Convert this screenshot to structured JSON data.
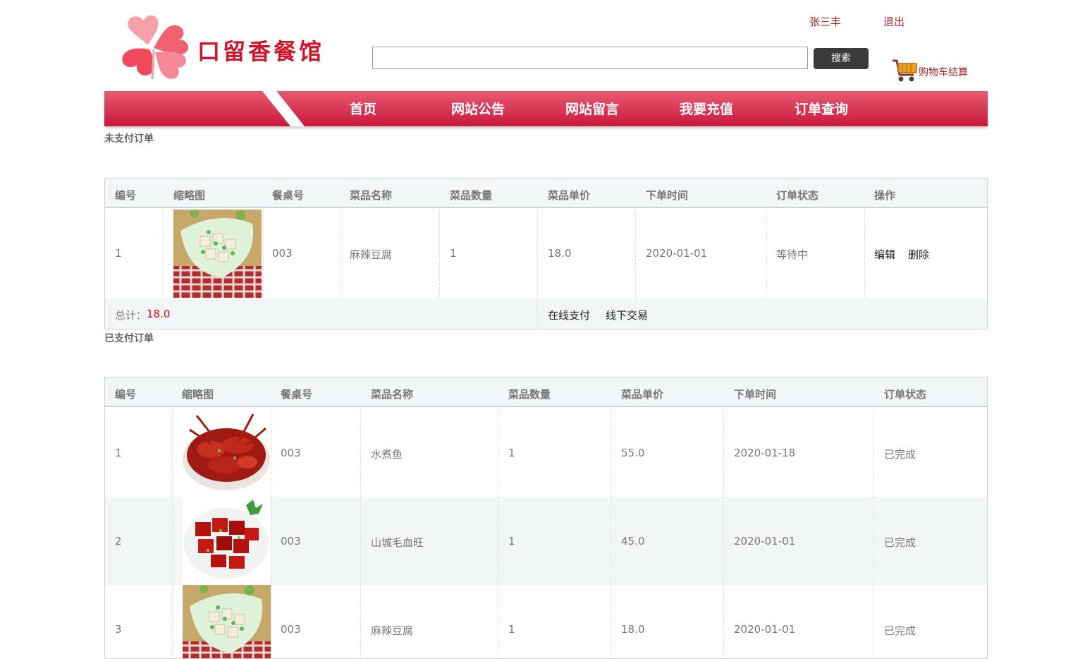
{
  "header": {
    "logo_text": "口留香餐馆",
    "user_name": "张三丰",
    "logout": "退出",
    "search_input_value": "",
    "search_button": "搜索",
    "cart_label": "购物车结算"
  },
  "nav": {
    "items": [
      "首页",
      "网站公告",
      "网站留言",
      "我要充值",
      "订单查询"
    ]
  },
  "unpaid": {
    "title": "未支付订单",
    "columns": [
      "编号",
      "缩略图",
      "餐桌号",
      "菜品名称",
      "菜品数量",
      "菜品单价",
      "下单时间",
      "订单状态",
      "操作"
    ],
    "rows": [
      {
        "id": "1",
        "thumb": "tofu-dish",
        "table": "003",
        "name": "麻辣豆腐",
        "qty": "1",
        "price": "18.0",
        "time": "2020-01-01",
        "status": "等待中",
        "edit": "编辑",
        "delete": "删除"
      }
    ],
    "total_label": "总计：",
    "total_value": "18.0",
    "pay_online": "在线支付",
    "pay_offline": "线下交易"
  },
  "paid": {
    "title": "已支付订单",
    "columns": [
      "编号",
      "缩略图",
      "餐桌号",
      "菜品名称",
      "菜品数量",
      "菜品单价",
      "下单时间",
      "订单状态"
    ],
    "rows": [
      {
        "id": "1",
        "thumb": "crayfish-dish",
        "table": "003",
        "name": "水煮鱼",
        "qty": "1",
        "price": "55.0",
        "time": "2020-01-18",
        "status": "已完成"
      },
      {
        "id": "2",
        "thumb": "braised-pork-dish",
        "table": "003",
        "name": "山城毛血旺",
        "qty": "1",
        "price": "45.0",
        "time": "2020-01-01",
        "status": "已完成"
      },
      {
        "id": "3",
        "thumb": "tofu-dish",
        "table": "003",
        "name": "麻辣豆腐",
        "qty": "1",
        "price": "18.0",
        "time": "2020-01-01",
        "status": "已完成"
      }
    ]
  },
  "colors": {
    "brand": "#d0152b",
    "nav": "#d42a4a",
    "link": "#a8242c",
    "total": "#e60012"
  }
}
